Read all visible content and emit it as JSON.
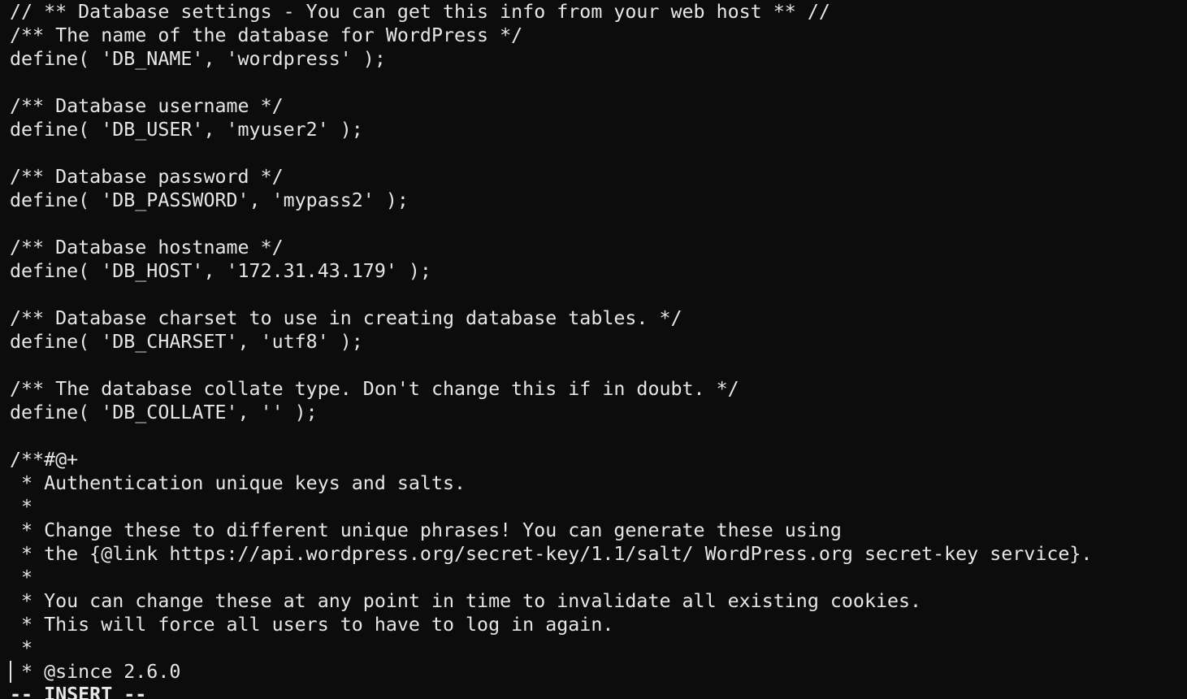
{
  "editor": {
    "lines": [
      "// ** Database settings - You can get this info from your web host ** //",
      "/** The name of the database for WordPress */",
      "define( 'DB_NAME', 'wordpress' );",
      "",
      "/** Database username */",
      "define( 'DB_USER', 'myuser2' );",
      "",
      "/** Database password */",
      "define( 'DB_PASSWORD', 'mypass2' );",
      "",
      "/** Database hostname */",
      "define( 'DB_HOST', '172.31.43.179' );",
      "",
      "/** Database charset to use in creating database tables. */",
      "define( 'DB_CHARSET', 'utf8' );",
      "",
      "/** The database collate type. Don't change this if in doubt. */",
      "define( 'DB_COLLATE', '' );",
      "",
      "/**#@+",
      " * Authentication unique keys and salts.",
      " *",
      " * Change these to different unique phrases! You can generate these using",
      " * the {@link https://api.wordpress.org/secret-key/1.1/salt/ WordPress.org secret-key service}.",
      " *",
      " * You can change these at any point in time to invalidate all existing cookies.",
      " * This will force all users to have to log in again.",
      " *",
      " * @since 2.6.0"
    ],
    "mode": "-- INSERT --"
  },
  "colors": {
    "background": "#0c0c0c",
    "foreground": "#e6e6e6"
  }
}
